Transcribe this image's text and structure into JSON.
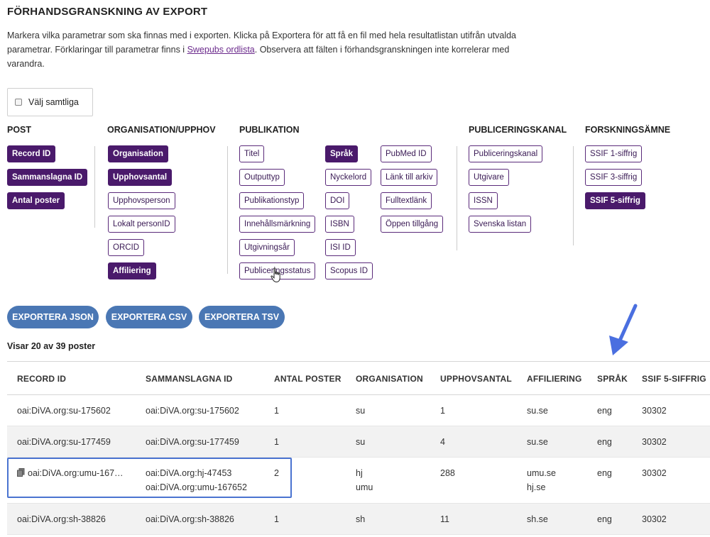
{
  "header": {
    "title": "FÖRHANDSGRANSKNING AV EXPORT",
    "intro_before_link": "Markera vilka parametrar som ska finnas med i exporten. Klicka på Exportera för att få en fil med hela resultatlistan utifrån utvalda parametrar. Förklaringar till parametrar finns i ",
    "intro_link": "Swepubs ordlista",
    "intro_after_link": ". Observera att fälten i förhandsgranskningen inte korrelerar med varandra."
  },
  "select_all": {
    "label": "Välj samtliga",
    "checked": false
  },
  "groups": {
    "post": {
      "heading": "POST",
      "tags": [
        {
          "label": "Record ID",
          "selected": true
        },
        {
          "label": "Sammanslagna ID",
          "selected": true
        },
        {
          "label": "Antal poster",
          "selected": true
        }
      ]
    },
    "organisation": {
      "heading": "ORGANISATION/UPPHOV",
      "tags": [
        {
          "label": "Organisation",
          "selected": true
        },
        {
          "label": "Upphovsantal",
          "selected": true
        },
        {
          "label": "Upphovsperson",
          "selected": false
        },
        {
          "label": "Lokalt personID",
          "selected": false
        },
        {
          "label": "ORCID",
          "selected": false
        },
        {
          "label": "Affiliering",
          "selected": true
        }
      ]
    },
    "publikation": {
      "heading": "PUBLIKATION",
      "tags": [
        {
          "label": "Titel",
          "selected": false
        },
        {
          "label": "Outputtyp",
          "selected": false
        },
        {
          "label": "Publikationstyp",
          "selected": false
        },
        {
          "label": "Innehållsmärkning",
          "selected": false
        },
        {
          "label": "Utgivningsår",
          "selected": false
        },
        {
          "label": "Publiceringsstatus",
          "selected": false
        },
        {
          "label": "Språk",
          "selected": true
        },
        {
          "label": "Nyckelord",
          "selected": false
        },
        {
          "label": "DOI",
          "selected": false
        },
        {
          "label": "ISBN",
          "selected": false
        },
        {
          "label": "ISI ID",
          "selected": false
        },
        {
          "label": "Scopus ID",
          "selected": false
        },
        {
          "label": "PubMed ID",
          "selected": false
        },
        {
          "label": "Länk till arkiv",
          "selected": false
        },
        {
          "label": "Fulltextlänk",
          "selected": false
        },
        {
          "label": "Öppen tillgång",
          "selected": false
        }
      ]
    },
    "kanal": {
      "heading": "PUBLICERINGSKANAL",
      "tags": [
        {
          "label": "Publiceringskanal",
          "selected": false
        },
        {
          "label": "Utgivare",
          "selected": false
        },
        {
          "label": "ISSN",
          "selected": false
        },
        {
          "label": "Svenska listan",
          "selected": false
        }
      ]
    },
    "amne": {
      "heading": "FORSKNINGSÄMNE",
      "tags": [
        {
          "label": "SSIF 1-siffrig",
          "selected": false
        },
        {
          "label": "SSIF 3-siffrig",
          "selected": false
        },
        {
          "label": "SSIF 5-siffrig",
          "selected": true
        }
      ]
    }
  },
  "buttons": {
    "json": "EXPORTERA JSON",
    "csv": "EXPORTERA CSV",
    "tsv": "EXPORTERA TSV"
  },
  "showing": "Visar 20 av 39 poster",
  "table": {
    "columns": [
      "RECORD ID",
      "SAMMANSLAGNA ID",
      "ANTAL POSTER",
      "ORGANISATION",
      "UPPHOVSANTAL",
      "AFFILIERING",
      "SPRÅK",
      "SSIF 5-SIFFRIG"
    ],
    "rows": [
      {
        "record_id": "oai:DiVA.org:su-175602",
        "merged": [
          "oai:DiVA.org:su-175602"
        ],
        "count": "1",
        "org": [
          "su"
        ],
        "authors": "1",
        "affil": [
          "su.se"
        ],
        "lang": "eng",
        "ssif": "30302"
      },
      {
        "record_id": "oai:DiVA.org:su-177459",
        "merged": [
          "oai:DiVA.org:su-177459"
        ],
        "count": "1",
        "org": [
          "su"
        ],
        "authors": "4",
        "affil": [
          "su.se"
        ],
        "lang": "eng",
        "ssif": "30302"
      },
      {
        "record_id": "oai:DiVA.org:umu-167…",
        "merged": [
          "oai:DiVA.org:hj-47453",
          "oai:DiVA.org:umu-167652"
        ],
        "count": "2",
        "org": [
          "hj",
          "umu"
        ],
        "authors": "288",
        "affil": [
          "umu.se",
          "hj.se"
        ],
        "lang": "eng",
        "ssif": "30302"
      },
      {
        "record_id": "oai:DiVA.org:sh-38826",
        "merged": [
          "oai:DiVA.org:sh-38826"
        ],
        "count": "1",
        "org": [
          "sh"
        ],
        "authors": "11",
        "affil": [
          "sh.se"
        ],
        "lang": "eng",
        "ssif": "30302"
      }
    ]
  },
  "colors": {
    "tag_selected": "#4a1a6b",
    "tag_border": "#5a2a7a",
    "button": "#4a77b4",
    "highlight": "#4a73d0",
    "arrow": "#4a6fe0"
  }
}
